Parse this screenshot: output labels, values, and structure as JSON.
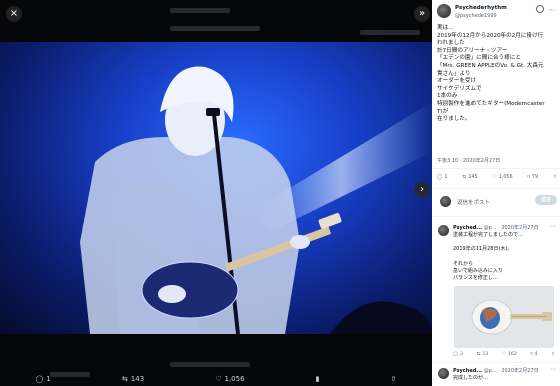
{
  "viewer": {
    "close_icon": "×",
    "expand_icon": "»",
    "next_icon": "›",
    "stats": {
      "replies": "1",
      "retweets": "143",
      "likes": "1,056"
    }
  },
  "tweet": {
    "display_name": "Psychederhythm",
    "handle": "@psychede1999",
    "text_lines": [
      "実は…",
      "",
      "2019年の12月から2020年の2月に掛け行",
      "われました",
      "計7日間のアリーナ・ツアー",
      "「エデンの園」に間に合う様にと",
      "「Mrs. GREEN APPLEのVo. & Gt. 大森元",
      "貴さん」より",
      "オーダーを受け",
      "サイケデリズムで",
      "1本のみ",
      "特別製作を進めてたギター(Moderncaster",
      "T)が",
      "在りました。"
    ],
    "timestamp": "午後3:10 · 2020年2月27日",
    "stats": {
      "replies": "1",
      "retweets": "145",
      "likes": "1,056",
      "bookmarks": "79"
    },
    "reply_placeholder": "返信をポスト",
    "reply_button": "返信"
  },
  "replies": [
    {
      "name": "Psyched...",
      "meta": "@p... · 2020年2月27日",
      "lines": [
        "塗装工程が完了しましたので…",
        "",
        "2019年の11月28日(木)。",
        "",
        "それから",
        "急いで組み込みに入り",
        "バランスを修正し…"
      ],
      "stats": {
        "replies": "2",
        "retweets": "13",
        "likes": "162",
        "bookmarks": "4"
      }
    },
    {
      "name": "Psyched...",
      "meta": "@p... · 2020年2月27日",
      "lines": [
        "完成したのが…"
      ]
    }
  ]
}
